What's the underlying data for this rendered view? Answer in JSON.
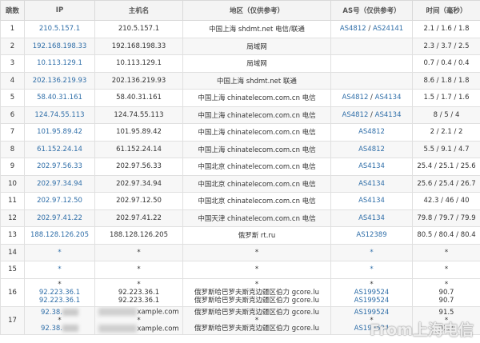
{
  "headers": [
    "跳数",
    "IP",
    "主机名",
    "地区（仅供参考）",
    "AS号（仅供参考）",
    "时间（毫秒）"
  ],
  "rows": [
    {
      "hop": "1",
      "ip": "210.5.157.1",
      "host": "210.5.157.1",
      "region": "中国上海 shdmt.net 电信/联通",
      "as1": "AS4812",
      "as_sep": " / ",
      "as2": "AS24141",
      "time": "2.1 / 1.6 / 1.8"
    },
    {
      "hop": "2",
      "ip": "192.168.198.33",
      "host": "192.168.198.33",
      "region": "局域网",
      "as1": "",
      "as_sep": "",
      "as2": "",
      "time": "2.3 / 3.7 / 2.5"
    },
    {
      "hop": "3",
      "ip": "10.113.129.1",
      "host": "10.113.129.1",
      "region": "局域网",
      "as1": "",
      "as_sep": "",
      "as2": "",
      "time": "0.7 / 0.4 / 0.4"
    },
    {
      "hop": "4",
      "ip": "202.136.219.93",
      "host": "202.136.219.93",
      "region": "中国上海 shdmt.net 联通",
      "as1": "",
      "as_sep": "",
      "as2": "",
      "time": "8.6 / 1.8 / 1.8"
    },
    {
      "hop": "5",
      "ip": "58.40.31.161",
      "host": "58.40.31.161",
      "region": "中国上海 chinatelecom.com.cn 电信",
      "as1": "AS4812",
      "as_sep": " / ",
      "as2": "AS4134",
      "time": "1.5 / 1.7 / 1.6"
    },
    {
      "hop": "6",
      "ip": "124.74.55.113",
      "host": "124.74.55.113",
      "region": "中国上海 chinatelecom.com.cn 电信",
      "as1": "AS4812",
      "as_sep": " / ",
      "as2": "AS4134",
      "time": "8 / 5 / 4"
    },
    {
      "hop": "7",
      "ip": "101.95.89.42",
      "host": "101.95.89.42",
      "region": "中国上海 chinatelecom.com.cn 电信",
      "as1": "AS4812",
      "as_sep": "",
      "as2": "",
      "time": "2 / 2.1 / 2"
    },
    {
      "hop": "8",
      "ip": "61.152.24.14",
      "host": "61.152.24.14",
      "region": "中国上海 chinatelecom.com.cn 电信",
      "as1": "AS4812",
      "as_sep": "",
      "as2": "",
      "time": "5.5 / 9.1 / 4.7"
    },
    {
      "hop": "9",
      "ip": "202.97.56.33",
      "host": "202.97.56.33",
      "region": "中国北京 chinatelecom.com.cn 电信",
      "as1": "AS4134",
      "as_sep": "",
      "as2": "",
      "time": "25.4 / 25.1 / 25.6"
    },
    {
      "hop": "10",
      "ip": "202.97.34.94",
      "host": "202.97.34.94",
      "region": "中国北京 chinatelecom.com.cn 电信",
      "as1": "AS4134",
      "as_sep": "",
      "as2": "",
      "time": "25.6 / 25.4 / 26.7"
    },
    {
      "hop": "11",
      "ip": "202.97.12.50",
      "host": "202.97.12.50",
      "region": "中国北京 chinatelecom.com.cn 电信",
      "as1": "AS4134",
      "as_sep": "",
      "as2": "",
      "time": "42.3 / 46 / 40"
    },
    {
      "hop": "12",
      "ip": "202.97.41.22",
      "host": "202.97.41.22",
      "region": "中国天津 chinatelecom.com.cn 电信",
      "as1": "AS4134",
      "as_sep": "",
      "as2": "",
      "time": "79.8 / 79.7 / 79.9"
    },
    {
      "hop": "13",
      "ip": "188.128.126.205",
      "host": "188.128.126.205",
      "region": "俄罗斯 rt.ru",
      "as1": "AS12389",
      "as_sep": "",
      "as2": "",
      "time": "80.5 / 80.4 / 80.4"
    },
    {
      "hop": "14",
      "ip": "*",
      "host": "*",
      "region": "*",
      "as1": "*",
      "as_sep": "",
      "as2": "",
      "time": "*"
    },
    {
      "hop": "15",
      "ip": "*",
      "host": "*",
      "region": "*",
      "as1": "*",
      "as_sep": "",
      "as2": "",
      "time": "*"
    }
  ],
  "row16": {
    "hop": "16",
    "lines": [
      {
        "ip": "*",
        "host": "*",
        "region": "*",
        "as": "*",
        "time": "*"
      },
      {
        "ip": "92.223.36.1",
        "host": "92.223.36.1",
        "region": "俄罗斯哈巴罗夫斯克边疆区伯力 gcore.lu",
        "as": "AS199524",
        "time": "90.7"
      },
      {
        "ip": "92.223.36.1",
        "host": "92.223.36.1",
        "region": "俄罗斯哈巴罗夫斯克边疆区伯力 gcore.lu",
        "as": "AS199524",
        "time": "90.7"
      }
    ]
  },
  "row17": {
    "hop": "17",
    "lines": [
      {
        "ip_prefix": "92.38.",
        "host_suffix": "xample.com",
        "region": "俄罗斯哈巴罗夫斯克边疆区伯力 gcore.lu",
        "as": "AS199524",
        "time": "91.5"
      },
      {
        "ip_prefix": "",
        "host_suffix": "",
        "region": "*",
        "as": "*",
        "time": "*"
      },
      {
        "ip_prefix": "92.38.",
        "host_suffix": "xample.com",
        "region": "俄罗斯哈巴罗夫斯克边疆区伯力 gcore.lu",
        "as": "AS199524",
        "time": "91.7"
      }
    ]
  },
  "watermark": "From上海电信"
}
